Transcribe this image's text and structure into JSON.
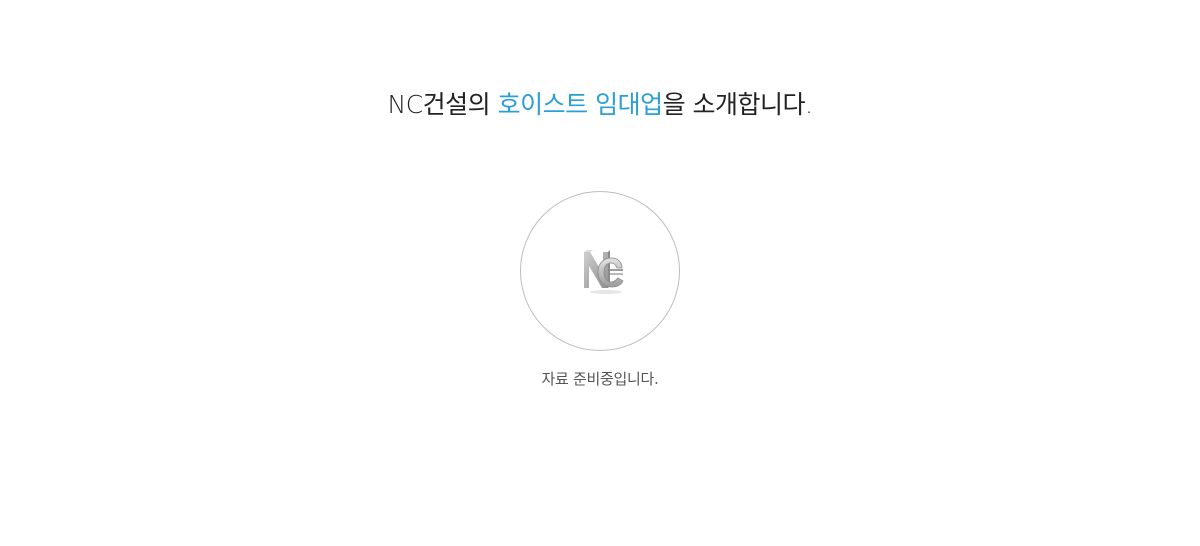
{
  "headline": {
    "prefix": "NC건설의 ",
    "highlight": "호이스트 임대업",
    "suffix": "을 소개합니다."
  },
  "logo": {
    "icon": "nc-logo-icon",
    "letters": "NC"
  },
  "status_text": "자료 준비중입니다.",
  "colors": {
    "accent": "#2a9fd8",
    "text": "#222222",
    "muted": "#555555",
    "circle_border": "#bdbdbd",
    "logo_gray": "#a8a8a8"
  }
}
